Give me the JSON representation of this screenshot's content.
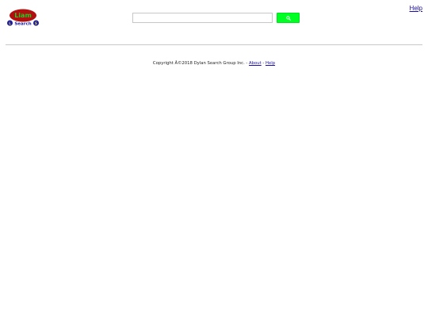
{
  "logo": {
    "top_text": "Liam",
    "bottom_text": "Search",
    "colors": {
      "ellipse": "#b01010",
      "top_text": "#22cc22",
      "bottom_text": "#1a1aa0",
      "badge": "#1a1aa0",
      "badge_text": "#f5e21a"
    }
  },
  "header": {
    "help_link": "Help"
  },
  "search": {
    "input_value": "",
    "button_icon": "search-icon",
    "button_color": "#00ff22"
  },
  "footer": {
    "copyright": "Copyright Â©2018 Dylan Search Group Inc. - ",
    "about_link": "About",
    "separator": " - ",
    "help_link": "Help"
  }
}
